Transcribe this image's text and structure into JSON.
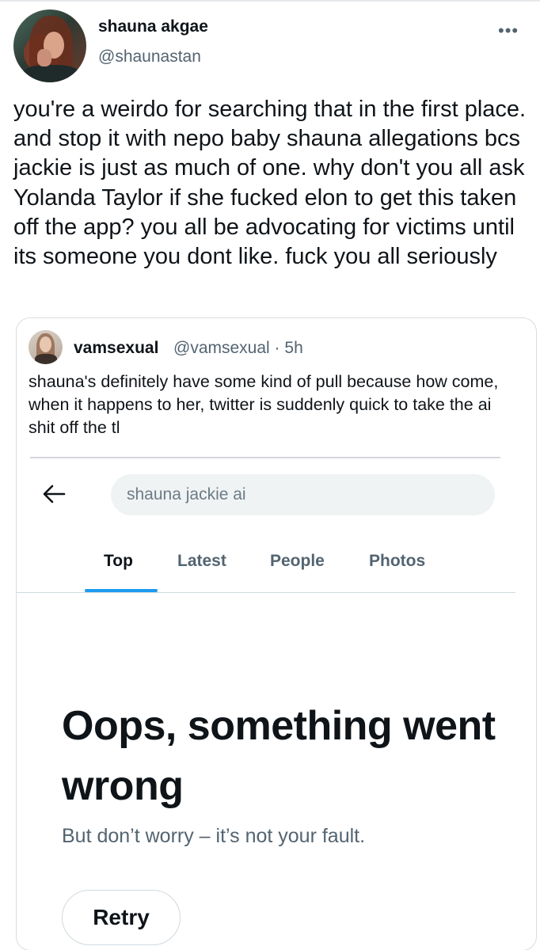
{
  "tweet": {
    "author_name": "shauna akgae",
    "author_handle": "@shaunastan",
    "more_glyph": "•••",
    "text": "you're a weirdo for searching that in the first place. and stop it with nepo baby shauna allegations bcs jackie is just as much of one. why don't you all ask Yolanda Taylor if she fucked elon to get this taken off the app? you all be advocating for victims until its someone you dont like. fuck you all seriously"
  },
  "quote": {
    "author_name": "vamsexual",
    "author_handle": "@vamsexual",
    "separator": "·",
    "time": "5h",
    "text": "shauna's definitely have some kind of pull because how come, when it happens to her, twitter is suddenly quick to take the ai shit off the tl"
  },
  "screenshot": {
    "search_query": "shauna jackie ai",
    "tabs": [
      {
        "label": "Top",
        "active": true
      },
      {
        "label": "Latest",
        "active": false
      },
      {
        "label": "People",
        "active": false
      },
      {
        "label": "Photos",
        "active": false
      }
    ],
    "error_title": "Oops, something went wrong",
    "error_subtitle": "But don’t worry – it’s not your fault.",
    "retry_label": "Retry",
    "accent_color": "#1d9bf0"
  }
}
